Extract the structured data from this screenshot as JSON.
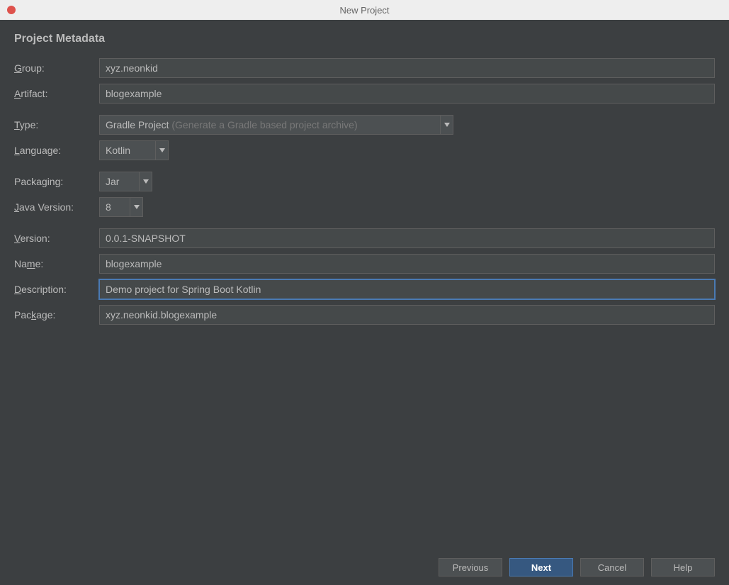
{
  "window": {
    "title": "New Project"
  },
  "section": {
    "heading": "Project Metadata"
  },
  "labels": {
    "group_pre": "",
    "group_m": "G",
    "group_post": "roup:",
    "artifact_pre": "",
    "artifact_m": "A",
    "artifact_post": "rtifact:",
    "type_pre": "",
    "type_m": "T",
    "type_post": "ype:",
    "language_pre": "",
    "language_m": "L",
    "language_post": "anguage:",
    "packaging": "Packaging:",
    "java_pre": "",
    "java_m": "J",
    "java_post": "ava Version:",
    "version_pre": "",
    "version_m": "V",
    "version_post": "ersion:",
    "name_pre": "Na",
    "name_m": "m",
    "name_post": "e:",
    "description_pre": "",
    "description_m": "D",
    "description_post": "escription:",
    "package_pre": "Pac",
    "package_m": "k",
    "package_post": "age:"
  },
  "fields": {
    "group": "xyz.neonkid",
    "artifact": "blogexample",
    "type": "Gradle Project",
    "type_hint": " (Generate a Gradle based project archive)",
    "language": "Kotlin",
    "packaging": "Jar",
    "java_version": "8",
    "version": "0.0.1-SNAPSHOT",
    "name": "blogexample",
    "description": "Demo project for Spring Boot Kotlin",
    "package": "xyz.neonkid.blogexample"
  },
  "buttons": {
    "previous": "Previous",
    "next": "Next",
    "cancel": "Cancel",
    "help": "Help"
  }
}
